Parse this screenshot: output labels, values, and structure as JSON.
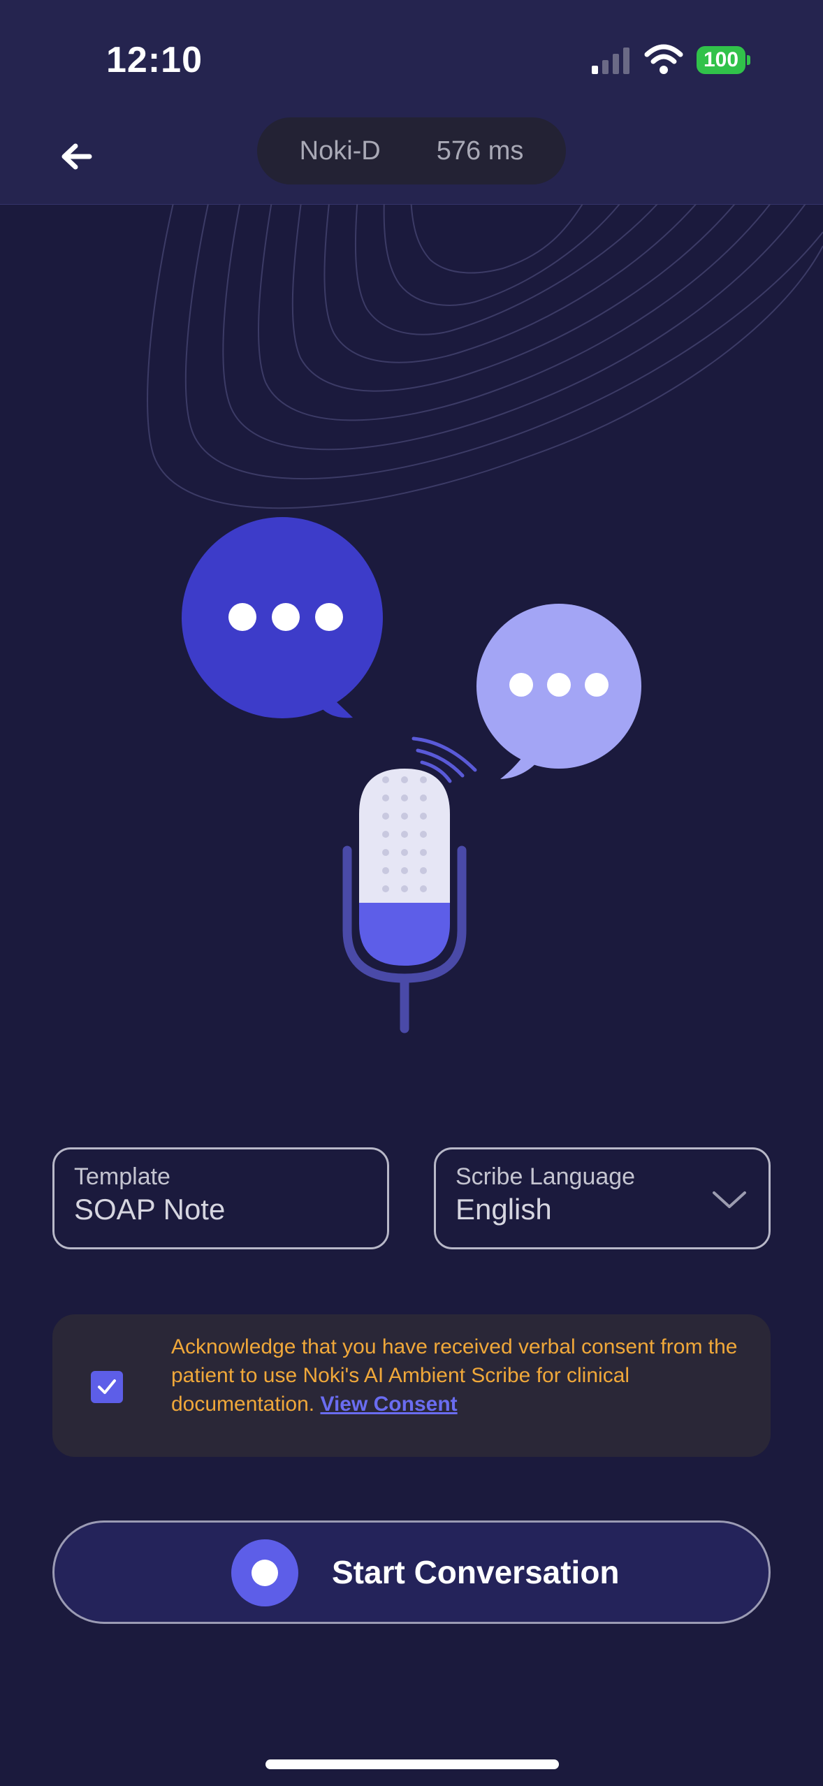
{
  "status_bar": {
    "time": "12:10",
    "battery": "100",
    "icons": [
      "signal-icon",
      "wifi-icon",
      "battery-icon"
    ]
  },
  "header": {
    "back_icon": "arrow-left-icon",
    "model_name": "Noki-D",
    "latency": "576 ms"
  },
  "illustration": {
    "icons": [
      "chat-bubble-icon",
      "chat-bubble-icon",
      "microphone-icon"
    ]
  },
  "form": {
    "template": {
      "label": "Template",
      "value": "SOAP Note"
    },
    "language": {
      "label": "Scribe Language",
      "value": "English",
      "icon": "chevron-down-icon"
    }
  },
  "consent": {
    "checked": true,
    "text": "Acknowledge that you have received verbal consent from the patient to use Noki's AI Ambient Scribe for clinical documentation.",
    "link": "View Consent"
  },
  "action": {
    "start_label": "Start Conversation"
  },
  "colors": {
    "background": "#1b1a3d",
    "header": "#25244f",
    "accent": "#5d5ee8",
    "consent_text": "#f0a83a",
    "battery": "#31c24a"
  }
}
